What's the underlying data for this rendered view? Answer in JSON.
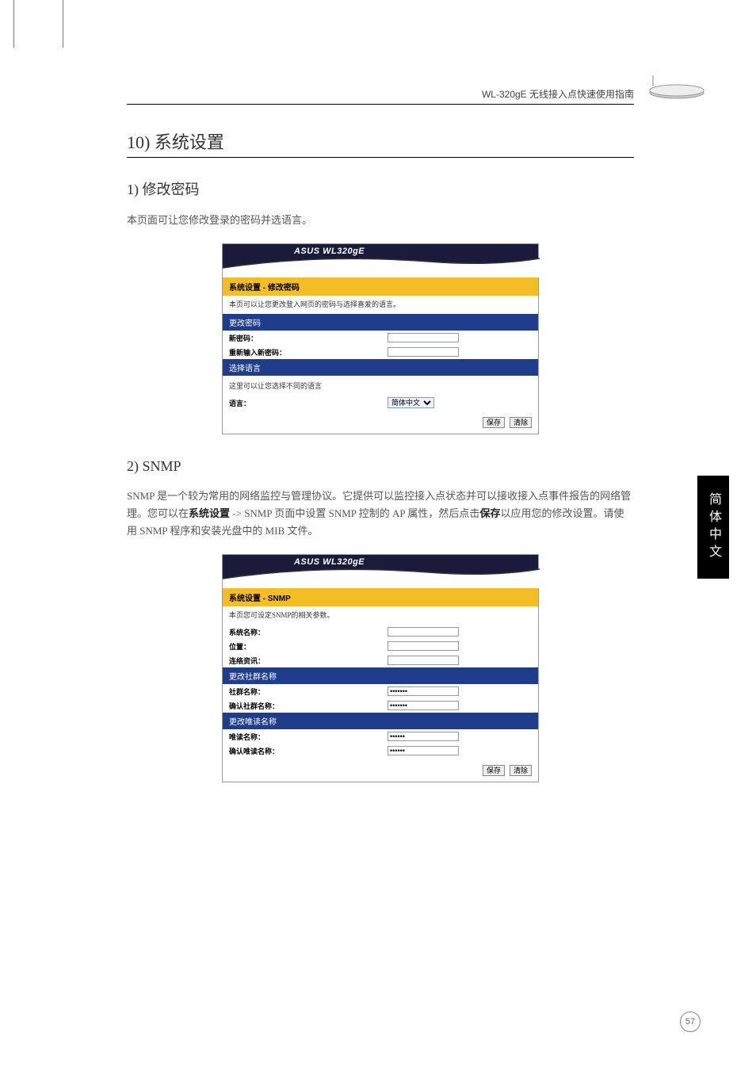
{
  "header": {
    "guide": "WL-320gE 无线接入点快速使用指南"
  },
  "section": {
    "title": "10) 系统设置",
    "s1": {
      "title": "1) 修改密码",
      "body": "本页面可让您修改登录的密码并选语言。"
    },
    "s2": {
      "title": "2) SNMP",
      "body_a": "SNMP 是一个较为常用的网络监控与管理协议。它提供可以监控接入点状态并可以接收接入点事件报告的网络管理。您可以在",
      "body_b": "系统设置",
      "body_c": " -> SNMP 页面中设置 SNMP 控制的 AP 属性，然后点击",
      "body_d": "保存",
      "body_e": "以应用您的修改设置。请使用 SNMP 程序和安装光盘中的 MIB 文件。"
    }
  },
  "shot1": {
    "product": "ASUS WL320gE",
    "crumb": "系统设置  - 修改密码",
    "desc": "本页可以让您更改登入网页的密码与选择喜爱的语言。",
    "bar1": "更改密码",
    "row_newpw": "新密码：",
    "row_newpw2": "重新输入新密码：",
    "bar2": "选择语言",
    "lang_desc": "这里可以让您选择不同的语言",
    "row_lang": "语言：",
    "lang_value": "简体中文",
    "btn_save": "保存",
    "btn_clear": "清除"
  },
  "shot2": {
    "product": "ASUS WL320gE",
    "crumb": "系统设置  - SNMP",
    "desc": "本页您可设定SNMP的相关参数。",
    "row_sysname": "系统名称：",
    "row_loc": "位置：",
    "row_contact": "连络资讯：",
    "bar1": "更改社群名称",
    "row_com": "社群名称：",
    "row_com2": "确认社群名称：",
    "bar2": "更改唯读名称",
    "row_ro": "唯读名称：",
    "row_ro2": "确认唯读名称：",
    "com_value": "•••••••",
    "ro_value": "••••••",
    "btn_save": "保存",
    "btn_clear": "清除"
  },
  "sidetab": "简体中文",
  "page_number": "57"
}
